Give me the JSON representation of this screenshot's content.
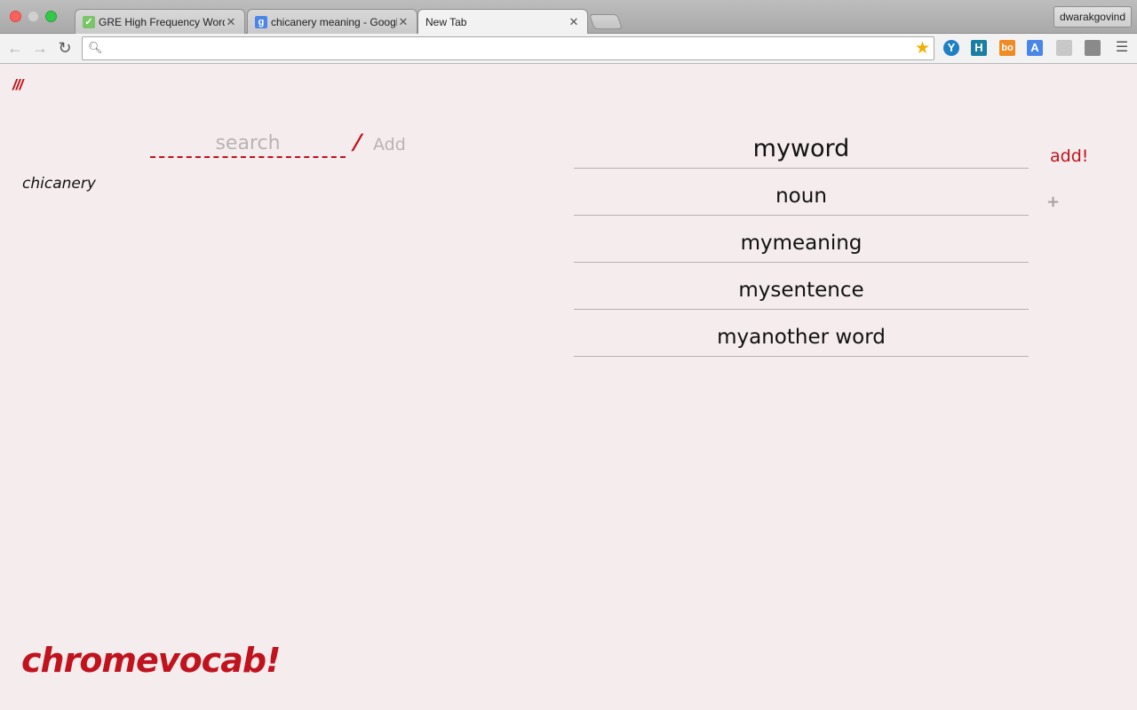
{
  "browser": {
    "tabs": [
      {
        "label": "GRE High Frequency Word",
        "favicon": "check-icon",
        "favicon_color": "#7cc46a",
        "active": false
      },
      {
        "label": "chicanery meaning - Googl",
        "favicon": "google-icon",
        "favicon_color": "#4a86e8",
        "active": false
      },
      {
        "label": "New Tab",
        "favicon": "",
        "active": true
      }
    ],
    "profile_name": "dwarakgovind",
    "omnibox": {
      "value": "",
      "placeholder": ""
    },
    "extensions": [
      {
        "name": "yoono-icon",
        "glyph": "Y",
        "color": "#1f7fc4"
      },
      {
        "name": "hacker-news-icon",
        "glyph": "H",
        "color": "#1a7fa0"
      },
      {
        "name": "bo-icon",
        "glyph": "bo",
        "color": "#f08a24"
      },
      {
        "name": "translate-icon",
        "glyph": "A",
        "color": "#4a86e8"
      },
      {
        "name": "extension-gray-icon",
        "glyph": "",
        "color": "#c8c8c8"
      },
      {
        "name": "extension-puzzle-icon",
        "glyph": "",
        "color": "#8a8a8a"
      }
    ]
  },
  "app": {
    "logo_mark": "///",
    "search": {
      "placeholder": "search",
      "value": ""
    },
    "separator": "/",
    "add_link": "Add",
    "words": [
      "chicanery"
    ],
    "form": {
      "word": "myword",
      "type": "noun",
      "meaning": "mymeaning",
      "sentence": "mysentence",
      "another": "myanother word"
    },
    "add_button": "add!",
    "plus_button": "+",
    "brand": "chromevocab!"
  },
  "colors": {
    "accent": "#c0131d",
    "background": "#f5eced",
    "muted": "#b9b3b4"
  }
}
